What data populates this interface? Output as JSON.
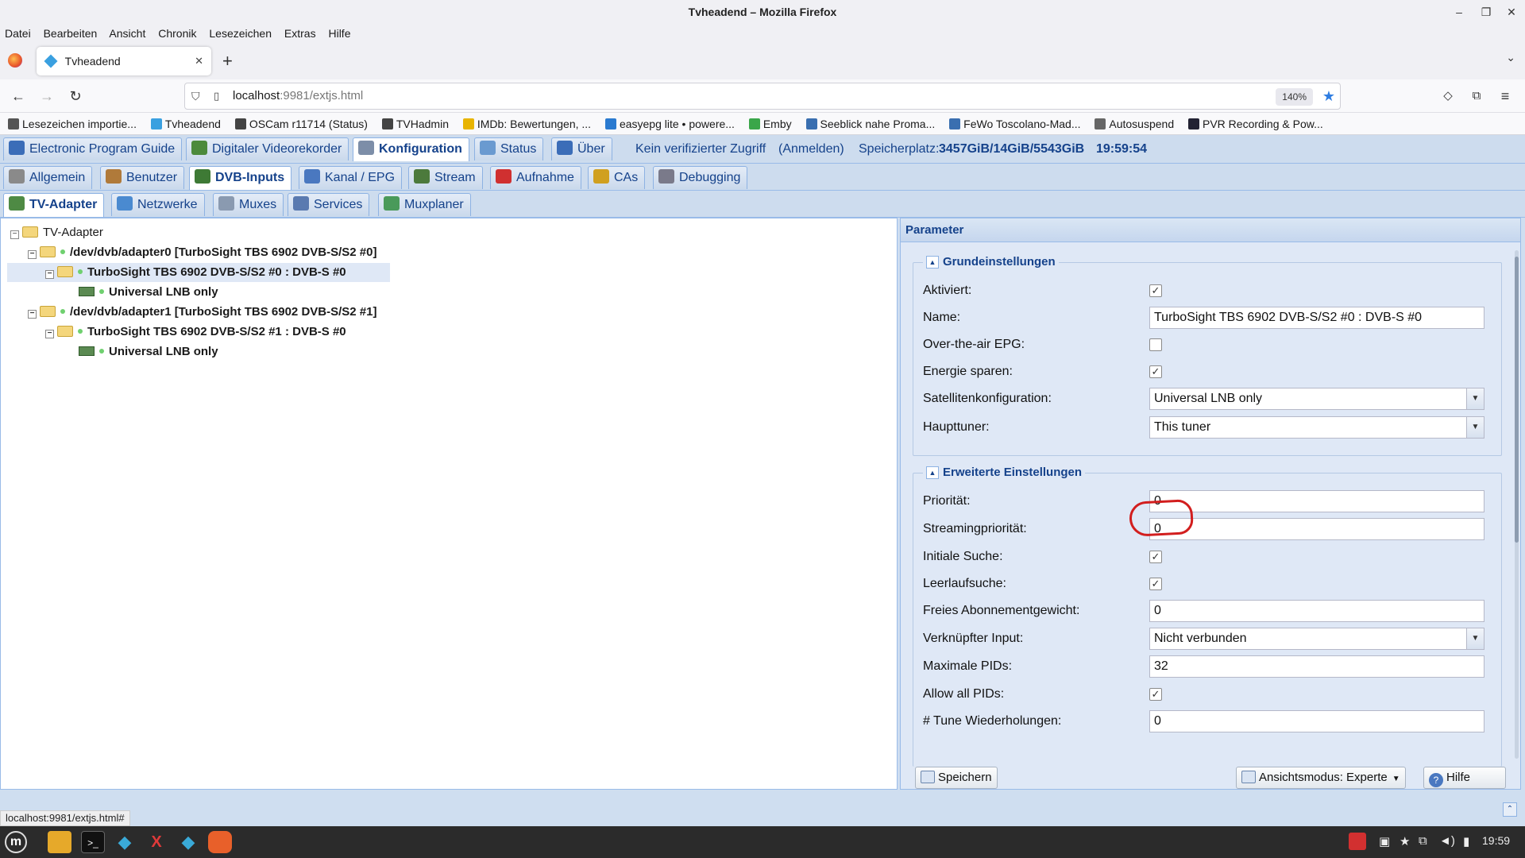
{
  "window": {
    "title": "Tvheadend – Mozilla Firefox"
  },
  "menu": [
    "Datei",
    "Bearbeiten",
    "Ansicht",
    "Chronik",
    "Lesezeichen",
    "Extras",
    "Hilfe"
  ],
  "tab": {
    "title": "Tvheadend"
  },
  "address": {
    "host": "localhost",
    "rest": ":9981/extjs.html",
    "zoom": "140%"
  },
  "bookmarks": [
    {
      "label": "Lesezeichen importie...",
      "color": "#555"
    },
    {
      "label": "Tvheadend",
      "color": "#3aa0e0"
    },
    {
      "label": "OSCam r11714 (Status)",
      "color": "#444"
    },
    {
      "label": "TVHadmin",
      "color": "#444"
    },
    {
      "label": "IMDb: Bewertungen, ...",
      "color": "#e8b400"
    },
    {
      "label": "easyepg lite • powere...",
      "color": "#2a7ad0"
    },
    {
      "label": "Emby",
      "color": "#3aa64a"
    },
    {
      "label": "Seeblick nahe Proma...",
      "color": "#3a6fb0"
    },
    {
      "label": "FeWo Toscolano-Mad...",
      "color": "#3a6fb0"
    },
    {
      "label": "Autosuspend",
      "color": "#666"
    },
    {
      "label": "PVR Recording & Pow...",
      "color": "#223"
    }
  ],
  "main_tabs": [
    {
      "label": "Electronic Program Guide",
      "color": "#3b6db8"
    },
    {
      "label": "Digitaler Videorekorder",
      "color": "#4c8a3c"
    },
    {
      "label": "Konfiguration",
      "color": "#7d8ea8"
    },
    {
      "label": "Status",
      "color": "#6a9ad0"
    },
    {
      "label": "Über",
      "color": "#3b6db8"
    }
  ],
  "top_info": {
    "access": "Kein verifizierter Zugriff",
    "login": "(Anmelden)",
    "storage_label": "Speicherplatz:",
    "storage_value": "3457GiB/14GiB/5543GiB",
    "time": "19:59:54"
  },
  "config_tabs": [
    {
      "label": "Allgemein",
      "color": "#8a8a8a"
    },
    {
      "label": "Benutzer",
      "color": "#b07a3a"
    },
    {
      "label": "DVB-Inputs",
      "color": "#3e7a35"
    },
    {
      "label": "Kanal / EPG",
      "color": "#4a78c0"
    },
    {
      "label": "Stream",
      "color": "#4c7a3c"
    },
    {
      "label": "Aufnahme",
      "color": "#d03030"
    },
    {
      "label": "CAs",
      "color": "#d0a020"
    },
    {
      "label": "Debugging",
      "color": "#7a7a8a"
    }
  ],
  "dvb_tabs": [
    {
      "label": "TV-Adapter",
      "color": "#4e8a44"
    },
    {
      "label": "Netzwerke",
      "color": "#4a8ad0"
    },
    {
      "label": "Muxes",
      "color": "#8a9ab0"
    },
    {
      "label": "Services",
      "color": "#5a7ab0"
    },
    {
      "label": "Muxplaner",
      "color": "#4a9a5a"
    }
  ],
  "tree": {
    "root": "TV-Adapter",
    "adapter0": "/dev/dvb/adapter0 [TurboSight TBS 6902 DVB-S/S2 #0]",
    "frontend0": "TurboSight TBS 6902 DVB-S/S2 #0 : DVB-S #0",
    "lnb0": "Universal LNB only",
    "adapter1": "/dev/dvb/adapter1 [TurboSight TBS 6902 DVB-S/S2 #1]",
    "frontend1": "TurboSight TBS 6902 DVB-S/S2 #1 : DVB-S #0",
    "lnb1": "Universal LNB only"
  },
  "params": {
    "title": "Parameter",
    "basic_title": "Grundeinstellungen",
    "advanced_title": "Erweiterte Einstellungen",
    "basic": {
      "aktiviert": "Aktiviert:",
      "name_label": "Name:",
      "name_value": "TurboSight TBS 6902 DVB-S/S2  #0 : DVB-S #0",
      "ota_epg": "Over-the-air EPG:",
      "energie": "Energie sparen:",
      "sat_label": "Satellitenkonfiguration:",
      "sat_value": "Universal LNB only",
      "haupt_label": "Haupttuner:",
      "haupt_value": "This tuner"
    },
    "advanced": {
      "prio_label": "Priorität:",
      "prio_value": "0",
      "sprio_label": "Streamingpriorität:",
      "sprio_value": "0",
      "initial_label": "Initiale Suche:",
      "idle_label": "Leerlaufsuche:",
      "free_label": "Freies Abonnementgewicht:",
      "free_value": "0",
      "linked_label": "Verknüpfter Input:",
      "linked_value": "Nicht verbunden",
      "maxpid_label": "Maximale PIDs:",
      "maxpid_value": "32",
      "allpid_label": "Allow all PIDs:",
      "tune_label": "# Tune Wiederholungen:",
      "tune_value": "0"
    },
    "checks": {
      "aktiviert": true,
      "ota_epg": false,
      "energie": true,
      "initial": true,
      "idle": true,
      "allpid": true
    },
    "buttons": {
      "save": "Speichern",
      "view": "Ansichtsmodus: Experte",
      "help": "Hilfe"
    }
  },
  "status_url": "localhost:9981/extjs.html#",
  "taskbar": {
    "clock": "19:59"
  },
  "annotation_color": "#d21e1e"
}
